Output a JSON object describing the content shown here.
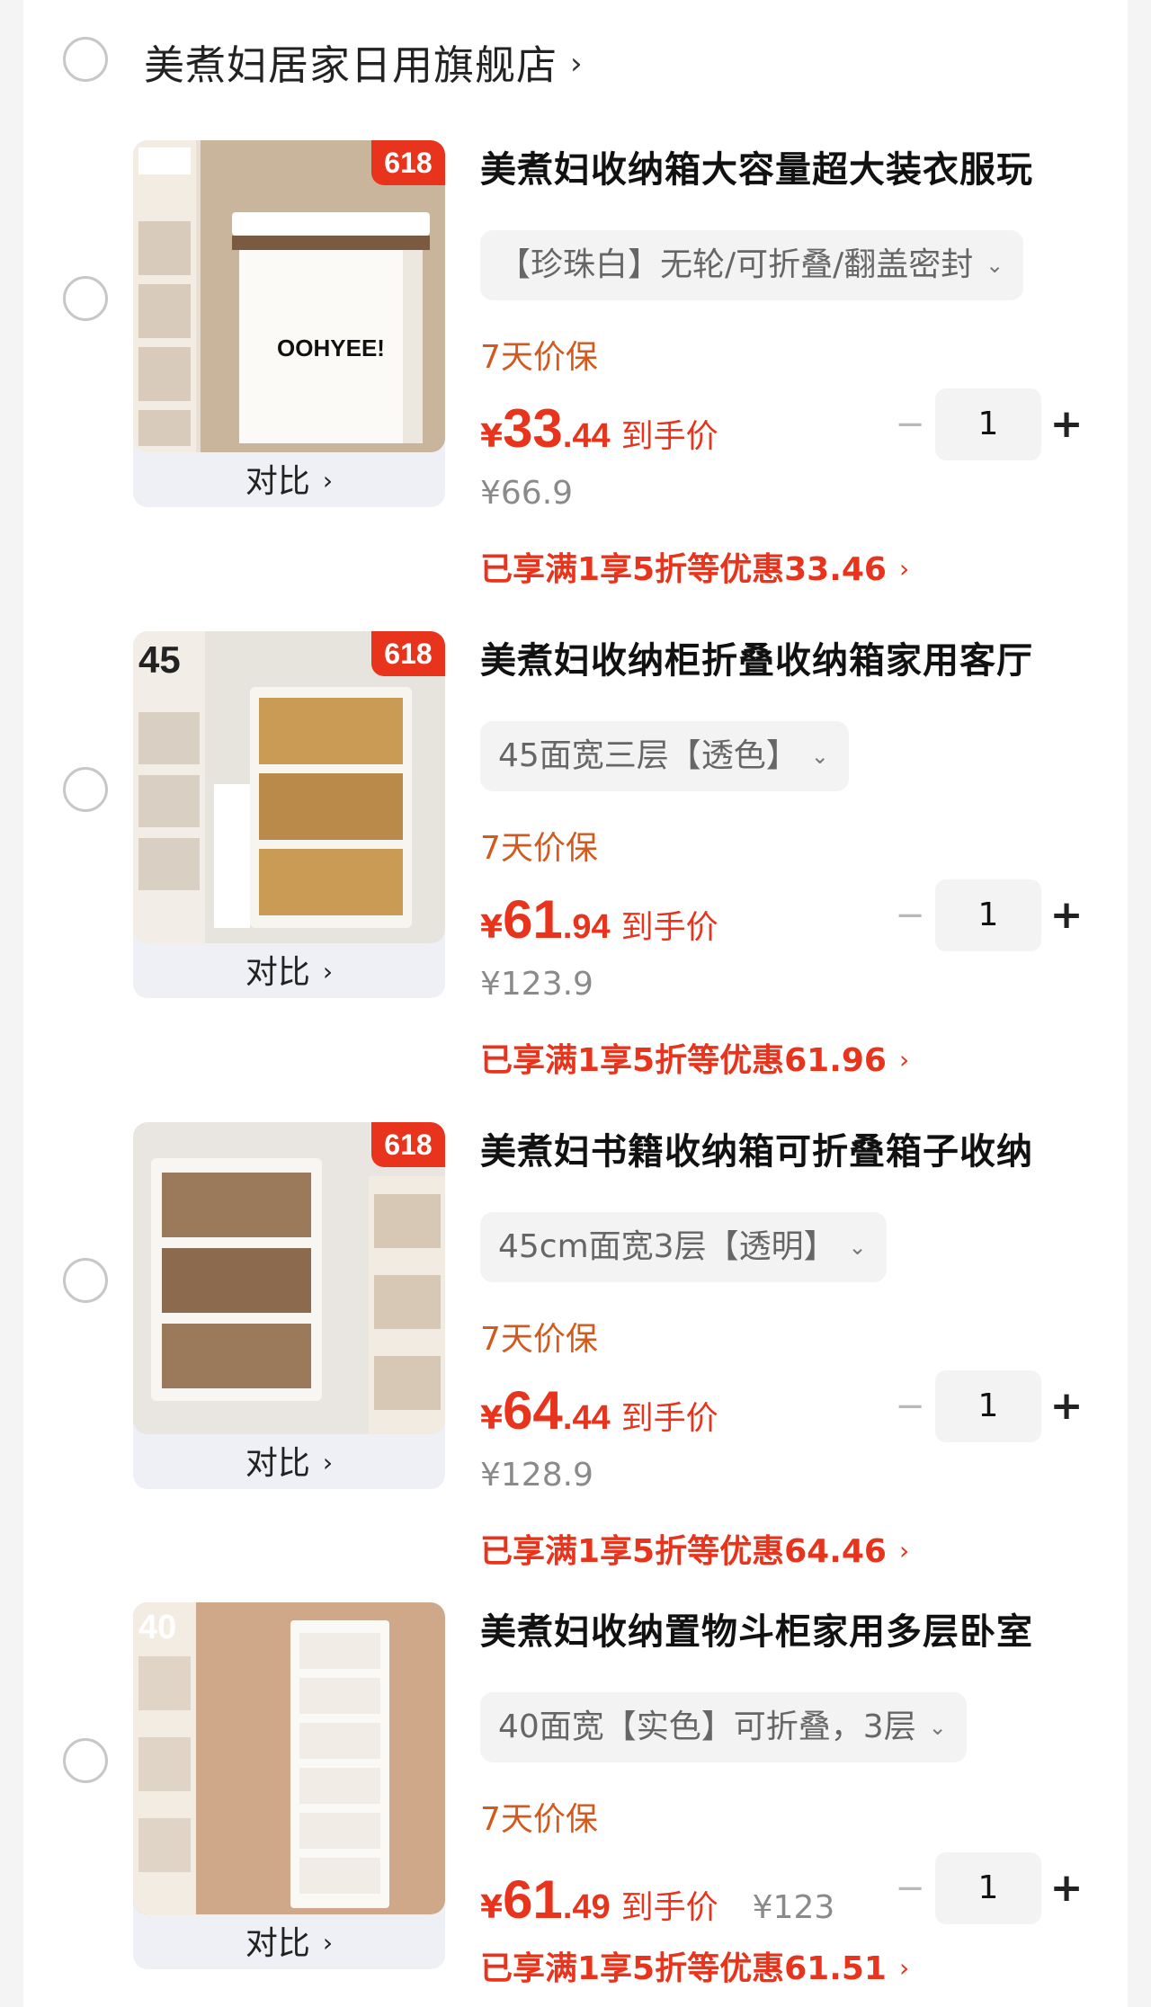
{
  "shop": {
    "name": "美煮妇居家日用旗舰店",
    "chevron": "›"
  },
  "compare_label": "对比",
  "chevron": "›",
  "promo_badge": "618",
  "items": [
    {
      "title": "美煮妇收纳箱大容量超大装衣服玩",
      "variant": "【珍珠白】无轮/可折叠/翻盖密封",
      "guarantee": "7天价保",
      "price_symbol": "¥",
      "price_int": "33",
      "price_dec": ".44",
      "price_label": "到手价",
      "original_price": "¥66.9",
      "promo_text": "已享满1享5折等优惠33.46",
      "quantity": "1",
      "minus": "−",
      "plus": "+",
      "thumb_caption": "OOHYEE!"
    },
    {
      "title": "美煮妇收纳柜折叠收纳箱家用客厅",
      "variant": "45面宽三层【透色】",
      "guarantee": "7天价保",
      "price_symbol": "¥",
      "price_int": "61",
      "price_dec": ".94",
      "price_label": "到手价",
      "original_price": "¥123.9",
      "promo_text": "已享满1享5折等优惠61.96",
      "quantity": "1",
      "minus": "−",
      "plus": "+",
      "thumb_caption": "45"
    },
    {
      "title": "美煮妇书籍收纳箱可折叠箱子收纳",
      "variant": "45cm面宽3层【透明】",
      "guarantee": "7天价保",
      "price_symbol": "¥",
      "price_int": "64",
      "price_dec": ".44",
      "price_label": "到手价",
      "original_price": "¥128.9",
      "promo_text": "已享满1享5折等优惠64.46",
      "quantity": "1",
      "minus": "−",
      "plus": "+",
      "thumb_caption": ""
    },
    {
      "title": "美煮妇收纳置物斗柜家用多层卧室",
      "variant": "40面宽【实色】可折叠，3层",
      "guarantee": "7天价保",
      "price_symbol": "¥",
      "price_int": "61",
      "price_dec": ".49",
      "price_label": "到手价",
      "original_price": "¥123",
      "promo_text": "已享满1享5折等优惠61.51",
      "quantity": "1",
      "minus": "−",
      "plus": "+",
      "thumb_caption": "40"
    }
  ],
  "colors": {
    "accent_red": "#e8341c",
    "guarantee_orange": "#d15a1e"
  }
}
